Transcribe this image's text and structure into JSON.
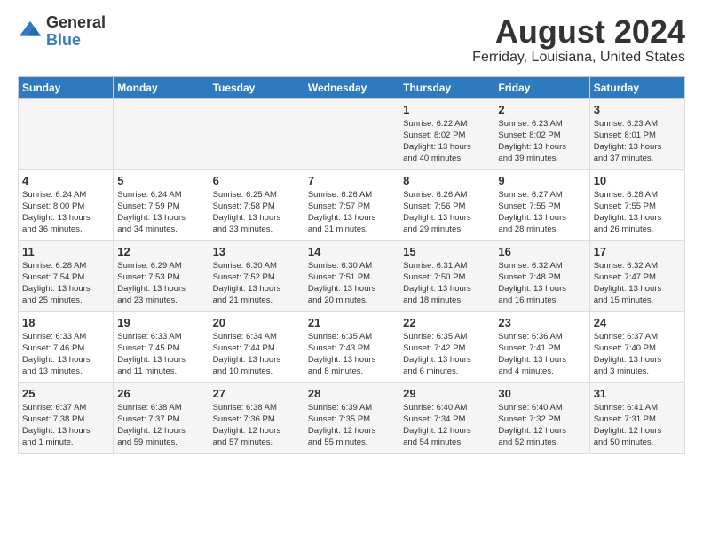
{
  "logo": {
    "line1": "General",
    "line2": "Blue"
  },
  "title": "August 2024",
  "subtitle": "Ferriday, Louisiana, United States",
  "weekdays": [
    "Sunday",
    "Monday",
    "Tuesday",
    "Wednesday",
    "Thursday",
    "Friday",
    "Saturday"
  ],
  "weeks": [
    [
      {
        "day": "",
        "info": ""
      },
      {
        "day": "",
        "info": ""
      },
      {
        "day": "",
        "info": ""
      },
      {
        "day": "",
        "info": ""
      },
      {
        "day": "1",
        "info": "Sunrise: 6:22 AM\nSunset: 8:02 PM\nDaylight: 13 hours\nand 40 minutes."
      },
      {
        "day": "2",
        "info": "Sunrise: 6:23 AM\nSunset: 8:02 PM\nDaylight: 13 hours\nand 39 minutes."
      },
      {
        "day": "3",
        "info": "Sunrise: 6:23 AM\nSunset: 8:01 PM\nDaylight: 13 hours\nand 37 minutes."
      }
    ],
    [
      {
        "day": "4",
        "info": "Sunrise: 6:24 AM\nSunset: 8:00 PM\nDaylight: 13 hours\nand 36 minutes."
      },
      {
        "day": "5",
        "info": "Sunrise: 6:24 AM\nSunset: 7:59 PM\nDaylight: 13 hours\nand 34 minutes."
      },
      {
        "day": "6",
        "info": "Sunrise: 6:25 AM\nSunset: 7:58 PM\nDaylight: 13 hours\nand 33 minutes."
      },
      {
        "day": "7",
        "info": "Sunrise: 6:26 AM\nSunset: 7:57 PM\nDaylight: 13 hours\nand 31 minutes."
      },
      {
        "day": "8",
        "info": "Sunrise: 6:26 AM\nSunset: 7:56 PM\nDaylight: 13 hours\nand 29 minutes."
      },
      {
        "day": "9",
        "info": "Sunrise: 6:27 AM\nSunset: 7:55 PM\nDaylight: 13 hours\nand 28 minutes."
      },
      {
        "day": "10",
        "info": "Sunrise: 6:28 AM\nSunset: 7:55 PM\nDaylight: 13 hours\nand 26 minutes."
      }
    ],
    [
      {
        "day": "11",
        "info": "Sunrise: 6:28 AM\nSunset: 7:54 PM\nDaylight: 13 hours\nand 25 minutes."
      },
      {
        "day": "12",
        "info": "Sunrise: 6:29 AM\nSunset: 7:53 PM\nDaylight: 13 hours\nand 23 minutes."
      },
      {
        "day": "13",
        "info": "Sunrise: 6:30 AM\nSunset: 7:52 PM\nDaylight: 13 hours\nand 21 minutes."
      },
      {
        "day": "14",
        "info": "Sunrise: 6:30 AM\nSunset: 7:51 PM\nDaylight: 13 hours\nand 20 minutes."
      },
      {
        "day": "15",
        "info": "Sunrise: 6:31 AM\nSunset: 7:50 PM\nDaylight: 13 hours\nand 18 minutes."
      },
      {
        "day": "16",
        "info": "Sunrise: 6:32 AM\nSunset: 7:48 PM\nDaylight: 13 hours\nand 16 minutes."
      },
      {
        "day": "17",
        "info": "Sunrise: 6:32 AM\nSunset: 7:47 PM\nDaylight: 13 hours\nand 15 minutes."
      }
    ],
    [
      {
        "day": "18",
        "info": "Sunrise: 6:33 AM\nSunset: 7:46 PM\nDaylight: 13 hours\nand 13 minutes."
      },
      {
        "day": "19",
        "info": "Sunrise: 6:33 AM\nSunset: 7:45 PM\nDaylight: 13 hours\nand 11 minutes."
      },
      {
        "day": "20",
        "info": "Sunrise: 6:34 AM\nSunset: 7:44 PM\nDaylight: 13 hours\nand 10 minutes."
      },
      {
        "day": "21",
        "info": "Sunrise: 6:35 AM\nSunset: 7:43 PM\nDaylight: 13 hours\nand 8 minutes."
      },
      {
        "day": "22",
        "info": "Sunrise: 6:35 AM\nSunset: 7:42 PM\nDaylight: 13 hours\nand 6 minutes."
      },
      {
        "day": "23",
        "info": "Sunrise: 6:36 AM\nSunset: 7:41 PM\nDaylight: 13 hours\nand 4 minutes."
      },
      {
        "day": "24",
        "info": "Sunrise: 6:37 AM\nSunset: 7:40 PM\nDaylight: 13 hours\nand 3 minutes."
      }
    ],
    [
      {
        "day": "25",
        "info": "Sunrise: 6:37 AM\nSunset: 7:38 PM\nDaylight: 13 hours\nand 1 minute."
      },
      {
        "day": "26",
        "info": "Sunrise: 6:38 AM\nSunset: 7:37 PM\nDaylight: 12 hours\nand 59 minutes."
      },
      {
        "day": "27",
        "info": "Sunrise: 6:38 AM\nSunset: 7:36 PM\nDaylight: 12 hours\nand 57 minutes."
      },
      {
        "day": "28",
        "info": "Sunrise: 6:39 AM\nSunset: 7:35 PM\nDaylight: 12 hours\nand 55 minutes."
      },
      {
        "day": "29",
        "info": "Sunrise: 6:40 AM\nSunset: 7:34 PM\nDaylight: 12 hours\nand 54 minutes."
      },
      {
        "day": "30",
        "info": "Sunrise: 6:40 AM\nSunset: 7:32 PM\nDaylight: 12 hours\nand 52 minutes."
      },
      {
        "day": "31",
        "info": "Sunrise: 6:41 AM\nSunset: 7:31 PM\nDaylight: 12 hours\nand 50 minutes."
      }
    ]
  ]
}
